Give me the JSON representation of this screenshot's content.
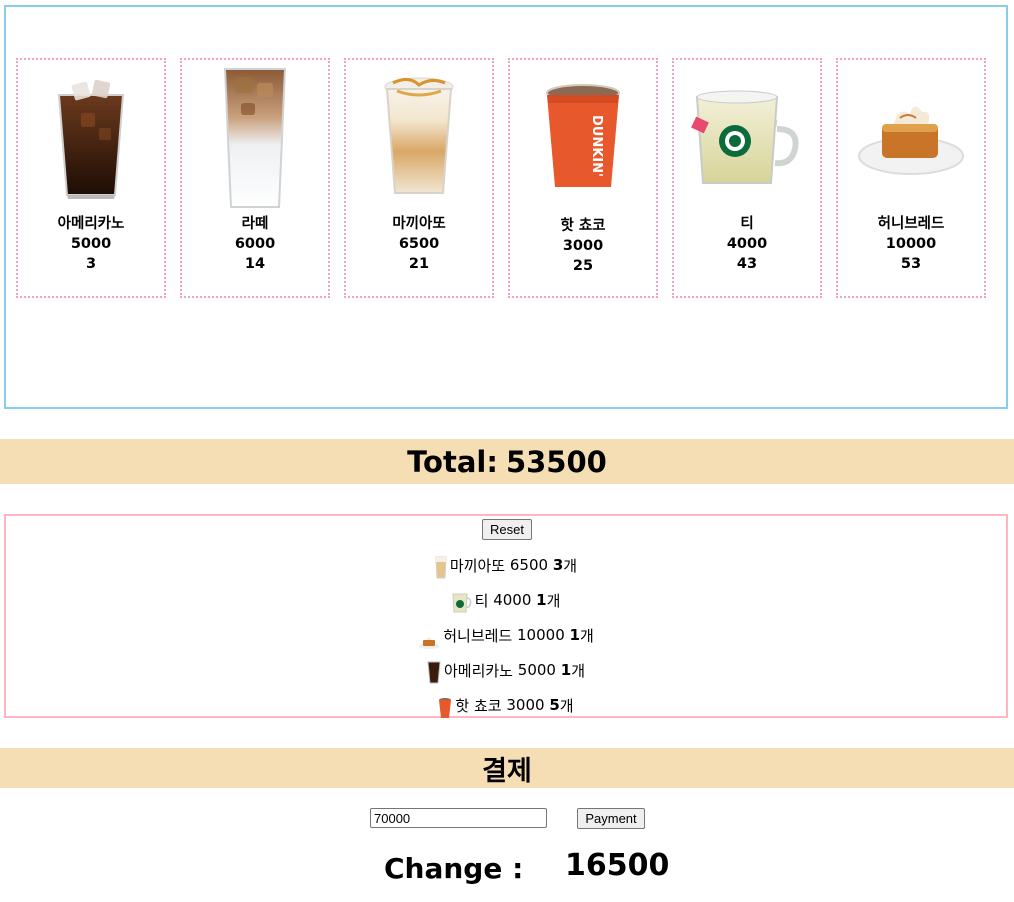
{
  "menu": {
    "items": [
      {
        "name": "아메리카노",
        "price": "5000",
        "count": "3",
        "icon": "iced-americano-icon"
      },
      {
        "name": "라떼",
        "price": "6000",
        "count": "14",
        "icon": "iced-latte-icon"
      },
      {
        "name": "마끼아또",
        "price": "6500",
        "count": "21",
        "icon": "iced-macchiato-icon"
      },
      {
        "name": "핫 쵸코",
        "price": "3000",
        "count": "25",
        "icon": "hot-chocolate-cup-icon"
      },
      {
        "name": "티",
        "price": "4000",
        "count": "43",
        "icon": "tea-glass-mug-icon"
      },
      {
        "name": "허니브레드",
        "price": "10000",
        "count": "53",
        "icon": "honey-bread-icon"
      }
    ]
  },
  "total": {
    "label": "Total:",
    "value": "53500"
  },
  "order": {
    "reset_label": "Reset",
    "rows": [
      {
        "name": "마끼아또",
        "price": "6500",
        "qty": "3",
        "unit": "개"
      },
      {
        "name": "티",
        "price": "4000",
        "qty": "1",
        "unit": "개"
      },
      {
        "name": "허니브레드",
        "price": "10000",
        "qty": "1",
        "unit": "개"
      },
      {
        "name": "아메리카노",
        "price": "5000",
        "qty": "1",
        "unit": "개"
      },
      {
        "name": "핫 쵸코",
        "price": "3000",
        "qty": "5",
        "unit": "개"
      }
    ]
  },
  "payment": {
    "title": "결제",
    "input_value": "70000",
    "button_label": "Payment",
    "change_label": "Change :",
    "change_value": "16500"
  },
  "colors": {
    "menu_border": "#87ceeb",
    "item_border": "#f5a0c0",
    "order_border": "#ffb6c1",
    "bar_bg": "#f5deb3"
  }
}
